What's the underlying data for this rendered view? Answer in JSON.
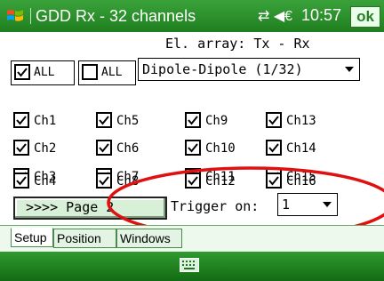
{
  "title_bar": {
    "app_title": "GDD Rx - 32 channels",
    "time": "10:57",
    "ok_label": "ok",
    "status_icons": [
      "connectivity-icon",
      "volume-icon"
    ]
  },
  "array_label": "El. array: Tx - Rx",
  "all_check_label": "ALL",
  "all_uncheck_label": "ALL",
  "array_select": {
    "value": "Dipole-Dipole (1/32)"
  },
  "channels": [
    {
      "label": "Ch1",
      "checked": true
    },
    {
      "label": "Ch2",
      "checked": true
    },
    {
      "label": "Ch3",
      "checked": true
    },
    {
      "label": "Ch4",
      "checked": true
    },
    {
      "label": "Ch5",
      "checked": true
    },
    {
      "label": "Ch6",
      "checked": true
    },
    {
      "label": "Ch7",
      "checked": true
    },
    {
      "label": "Ch8",
      "checked": true
    },
    {
      "label": "Ch9",
      "checked": true
    },
    {
      "label": "Ch10",
      "checked": true
    },
    {
      "label": "Ch11",
      "checked": true
    },
    {
      "label": "Ch12",
      "checked": true
    },
    {
      "label": "Ch13",
      "checked": true
    },
    {
      "label": "Ch14",
      "checked": true
    },
    {
      "label": "Ch15",
      "checked": true
    },
    {
      "label": "Ch16",
      "checked": true
    }
  ],
  "page_button_label": ">>>> Page 2",
  "trigger": {
    "label": "Trigger on:",
    "value": "1"
  },
  "tabs": [
    "Setup",
    "Position",
    "Windows"
  ],
  "colors": {
    "title_green": "#2a8f2a",
    "annotation_red": "#e01010"
  }
}
